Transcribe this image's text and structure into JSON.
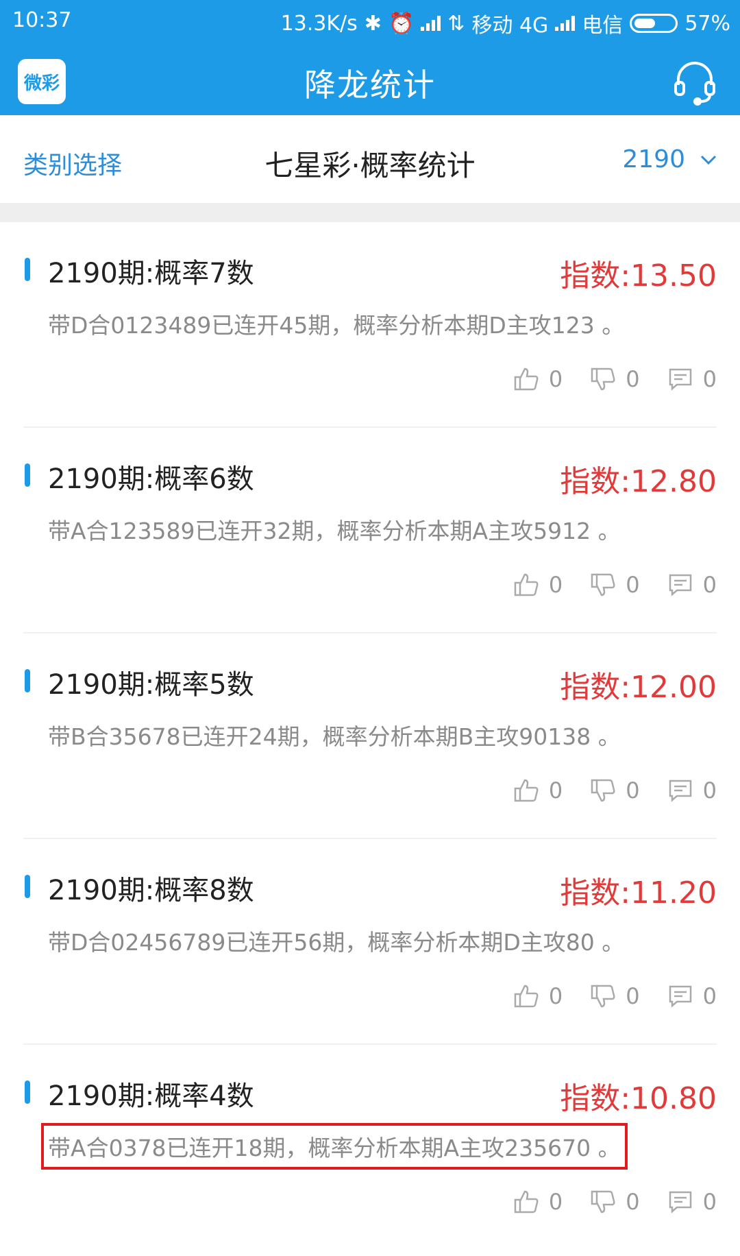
{
  "status_bar": {
    "time": "10:37",
    "speed": "13.3K/s",
    "carrier1": "移动 4G",
    "carrier2": "电信",
    "battery": "57%",
    "battery_level": 0.57
  },
  "app_bar": {
    "logo_text": "微彩",
    "title": "降龙统计"
  },
  "filter_bar": {
    "category_label": "类别选择",
    "title": "七星彩·概率统计",
    "issue": "2190"
  },
  "items": [
    {
      "title": "2190期:概率7数",
      "index": "指数:13.50",
      "desc": "带D合0123489已连开45期，概率分析本期D主攻123 。",
      "likes": "0",
      "dislikes": "0",
      "comments": "0"
    },
    {
      "title": "2190期:概率6数",
      "index": "指数:12.80",
      "desc": "带A合123589已连开32期，概率分析本期A主攻5912 。",
      "likes": "0",
      "dislikes": "0",
      "comments": "0"
    },
    {
      "title": "2190期:概率5数",
      "index": "指数:12.00",
      "desc": "带B合35678已连开24期，概率分析本期B主攻90138 。",
      "likes": "0",
      "dislikes": "0",
      "comments": "0"
    },
    {
      "title": "2190期:概率8数",
      "index": "指数:11.20",
      "desc": "带D合02456789已连开56期，概率分析本期D主攻80 。",
      "likes": "0",
      "dislikes": "0",
      "comments": "0"
    },
    {
      "title": "2190期:概率4数",
      "index": "指数:10.80",
      "desc": "带A合0378已连开18期，概率分析本期A主攻235670 。",
      "likes": "0",
      "dislikes": "0",
      "comments": "0"
    }
  ],
  "colors": {
    "brand_blue": "#1E9BE6",
    "index_red": "#E03A3A",
    "highlight_red": "#E01B1B"
  }
}
